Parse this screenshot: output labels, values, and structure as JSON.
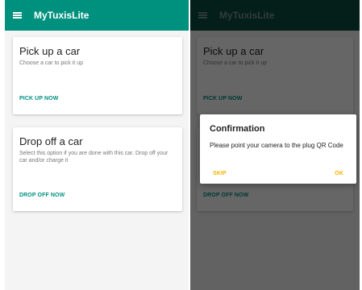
{
  "app": {
    "title": "MyTuxisLite"
  },
  "cards": {
    "pickup": {
      "title": "Pick up a car",
      "subtitle": "Choose a car to pick it up",
      "action": "PICK UP NOW"
    },
    "dropoff": {
      "title": "Drop off a car",
      "subtitle": "Select this option if you are done with this car. Drop off your car and/or charge it",
      "action": "DROP OFF NOW"
    }
  },
  "dialog": {
    "title": "Confirmation",
    "message": "Please point your camera to the plug QR Code",
    "skip_label": "SKIP",
    "ok_label": "OK"
  },
  "colors": {
    "primary": "#00917e",
    "primary_dimmed": "#0a4b41",
    "accent": "#f5b300"
  },
  "icons": {
    "menu": "hamburger-menu-icon"
  }
}
